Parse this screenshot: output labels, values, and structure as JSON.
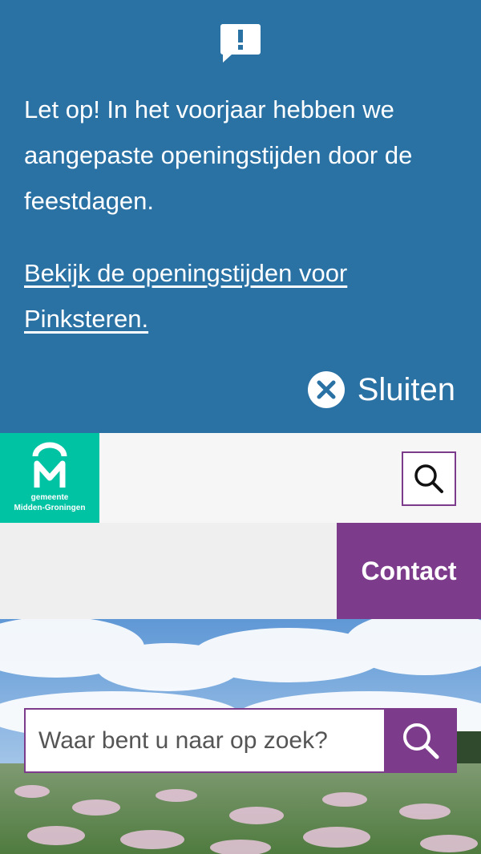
{
  "notice": {
    "icon": "speech-bubble-exclamation-icon",
    "message": "Let op! In het voorjaar hebben we aangepaste openingstijden door de feestdagen.",
    "link_text": "Bekijk de openingstijden voor Pinksteren.",
    "close_label": "Sluiten",
    "close_icon": "close-circle-icon",
    "background_color": "#2a71a4"
  },
  "header": {
    "logo": {
      "line1": "gemeente",
      "line2": "Midden-Groningen",
      "color": "#00c3a4"
    },
    "search_icon": "search-icon"
  },
  "nav": {
    "contact_label": "Contact",
    "accent_color": "#7d3b8c"
  },
  "search": {
    "placeholder": "Waar bent u naar op zoek?",
    "submit_icon": "search-icon"
  }
}
